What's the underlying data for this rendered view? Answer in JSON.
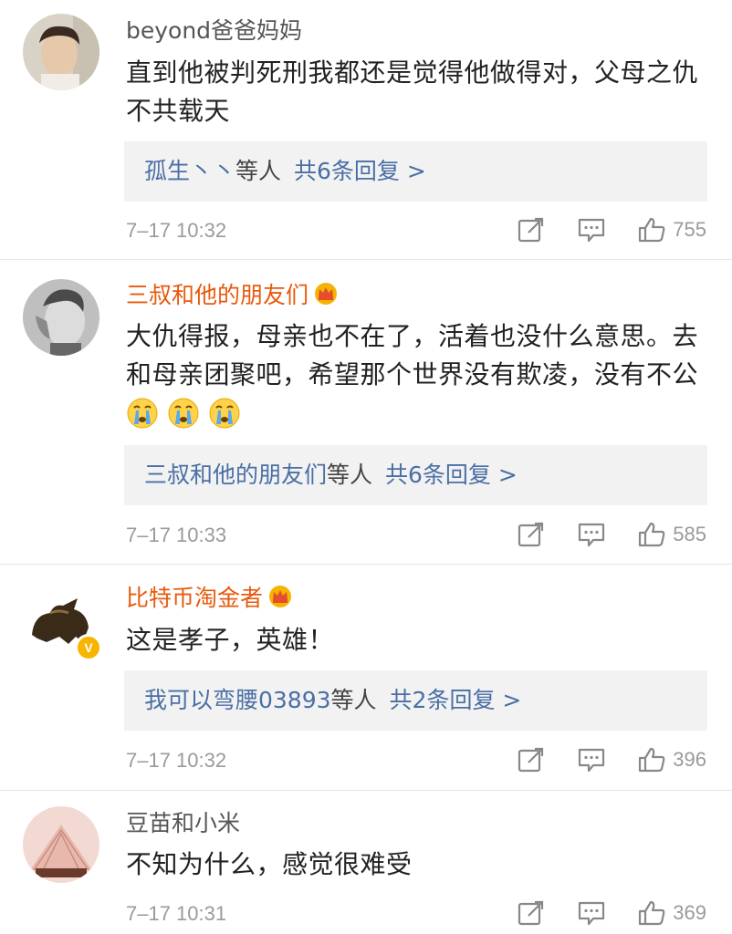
{
  "comments": [
    {
      "username": "beyond爸爸妈妈",
      "vip": false,
      "text_lines": [
        "直到他被判死刑我都还是觉得他做得对，父母之仇",
        "不共载天"
      ],
      "reply_names": "孤生丶丶",
      "reply_suffix": "等人",
      "reply_count": "共6条回复 >",
      "time": "7–17 10:32",
      "likes": "755"
    },
    {
      "username": "三叔和他的朋友们",
      "vip": true,
      "text_lines": [
        "大仇得报，母亲也不在了，活着也没什么意思。去",
        "和母亲团聚吧，希望那个世界没有欺凌，没有不公"
      ],
      "emojis": [
        "crying-face",
        "crying-face",
        "crying-face"
      ],
      "reply_names": "三叔和他的朋友们",
      "reply_suffix": "等人",
      "reply_count": "共6条回复 >",
      "time": "7–17 10:33",
      "likes": "585"
    },
    {
      "username": "比特币淘金者",
      "vip": true,
      "verified": "V",
      "text_lines": [
        "这是孝子，英雄！"
      ],
      "reply_names": "我可以弯腰03893",
      "reply_suffix": "等人",
      "reply_count": "共2条回复 >",
      "time": "7–17 10:32",
      "likes": "396"
    },
    {
      "username": "豆苗和小米",
      "vip": false,
      "text_lines": [
        "不知为什么，感觉很难受"
      ],
      "time": "7–17 10:31",
      "likes": "369"
    }
  ],
  "colors": {
    "vip_name": "#e8590c",
    "reply_link": "#4a6fa5",
    "meta": "#9a9a9a",
    "reply_bg": "#f2f2f2"
  },
  "icons": [
    "repost-icon",
    "comment-icon",
    "like-icon",
    "crown-icon",
    "crying-face-emoji",
    "verified-badge"
  ]
}
